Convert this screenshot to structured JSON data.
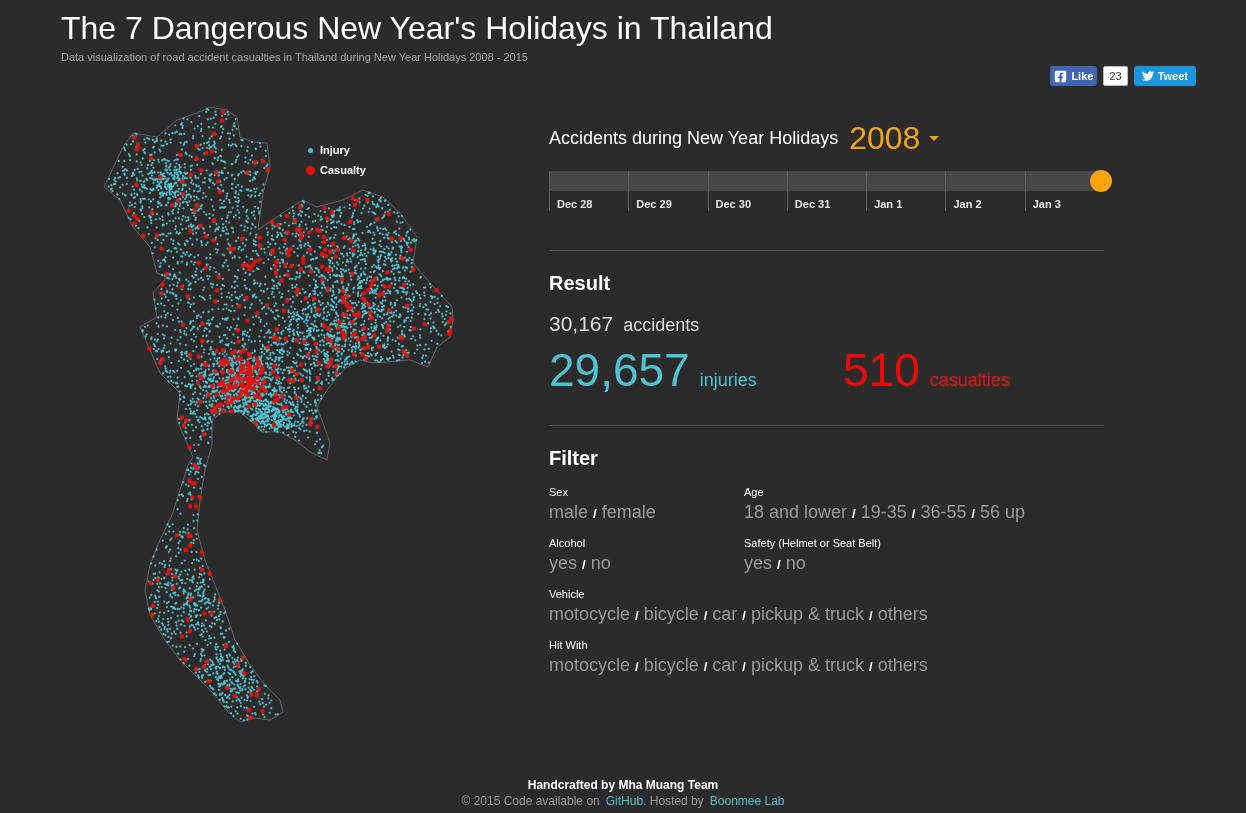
{
  "header": {
    "title": "The 7 Dangerous New Year's Holidays in Thailand",
    "subtitle": "Data visualization of road accident casualties in Thailand during New Year Holidays 2008 - 2015"
  },
  "social": {
    "like": {
      "label": "Like",
      "count": "23"
    },
    "tweet": {
      "label": "Tweet"
    }
  },
  "map": {
    "legend": [
      {
        "kind": "small",
        "label": "Injury",
        "color": "#4fc1cf"
      },
      {
        "kind": "large",
        "label": "Casualty",
        "color": "#ff0000"
      }
    ]
  },
  "timeline": {
    "heading": "Accidents during New Year Holidays",
    "year": "2008",
    "days": [
      "Dec 28",
      "Dec 29",
      "Dec 30",
      "Dec 31",
      "Jan 1",
      "Jan 2",
      "Jan 3"
    ],
    "level": 1
  },
  "result": {
    "title": "Result",
    "accidents": {
      "value": "30,167",
      "label": "accidents"
    },
    "injuries": {
      "value": "29,657",
      "label": "injuries"
    },
    "casualties": {
      "value": "510",
      "label": "casualties"
    }
  },
  "filter": {
    "title": "Filter",
    "rows": [
      [
        {
          "label": "Sex",
          "options": [
            {
              "text": "male"
            },
            {
              "separator": "/",
              "text": "female"
            }
          ]
        },
        {
          "label": "Age",
          "options": [
            {
              "text": "18 and lower"
            },
            {
              "separator": "/",
              "text": "19-35"
            },
            {
              "separator": "/",
              "text": "36-55"
            },
            {
              "separator": "/",
              "text": "56 up"
            }
          ]
        }
      ],
      [
        {
          "label": "Alcohol",
          "options": [
            {
              "text": "yes"
            },
            {
              "separator": "/",
              "text": "no"
            }
          ]
        },
        {
          "label": "Safety (Helmet or Seat Belt)",
          "options": [
            {
              "text": "yes"
            },
            {
              "separator": "/",
              "text": "no"
            }
          ]
        }
      ],
      [
        {
          "label": "Vehicle",
          "options": [
            {
              "text": "motocycle"
            },
            {
              "separator": "/",
              "text": "bicycle"
            },
            {
              "separator": "/",
              "text": "car"
            },
            {
              "separator": "/",
              "text": "pickup & truck"
            },
            {
              "separator": "/",
              "text": "others"
            }
          ]
        }
      ],
      [
        {
          "label": "Hit With",
          "options": [
            {
              "text": "motocycle"
            },
            {
              "separator": "/",
              "text": "bicycle"
            },
            {
              "separator": "/",
              "text": "car"
            },
            {
              "separator": "/",
              "text": "pickup & truck"
            },
            {
              "separator": "/",
              "text": "others"
            }
          ]
        }
      ]
    ]
  },
  "footer": {
    "team": "Handcrafted by Mha Muang Team",
    "credits": [
      {
        "kind": "text",
        "text": "© 2015 Code available on"
      },
      {
        "kind": "link",
        "text": "GitHub"
      },
      {
        "kind": "text",
        "text": ". Hosted by"
      },
      {
        "kind": "link",
        "text": "Boonmee Lab"
      }
    ]
  }
}
